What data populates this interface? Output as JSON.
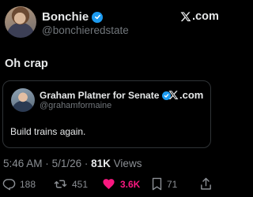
{
  "post": {
    "author_name": "Bonchie",
    "author_handle": "@bonchieredstate",
    "source_logo": ".com",
    "text": "Oh crap"
  },
  "quoted_post": {
    "author_name": "Graham Platner for Senate",
    "author_handle": "@grahamformaine",
    "source_logo": ".com",
    "text": "Build trains again."
  },
  "meta": {
    "time": "5:46 AM",
    "separator": "·",
    "date": "5/1/26",
    "views_count": "81K",
    "views_label": "Views"
  },
  "actions": {
    "replies": "188",
    "reposts": "451",
    "likes": "3.6K",
    "bookmarks": "71"
  },
  "colors": {
    "background": "#000000",
    "text": "#e7e9ea",
    "secondary": "#71767b",
    "verified": "#1d9bf0",
    "like": "#f91880"
  }
}
